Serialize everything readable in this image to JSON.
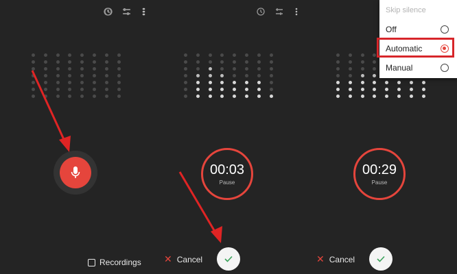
{
  "colors": {
    "accent": "#e5453c",
    "highlight_box": "#d7262a",
    "arrow": "#e02424",
    "background": "#242424"
  },
  "panel1": {
    "recordings_label": "Recordings",
    "record_button_icon": "mic-icon"
  },
  "panel2": {
    "time": "00:03",
    "pause_label": "Pause",
    "cancel_label": "Cancel",
    "save_icon": "check-icon"
  },
  "panel3": {
    "time": "00:29",
    "pause_label": "Pause",
    "cancel_label": "Cancel",
    "save_icon": "check-icon"
  },
  "toolbar_icons": [
    "clock-icon",
    "adjust-icon",
    "more-vert-icon"
  ],
  "menu": {
    "title": "Skip silence",
    "options": [
      {
        "label": "Off",
        "selected": false
      },
      {
        "label": "Automatic",
        "selected": true
      },
      {
        "label": "Manual",
        "selected": false
      }
    ]
  }
}
